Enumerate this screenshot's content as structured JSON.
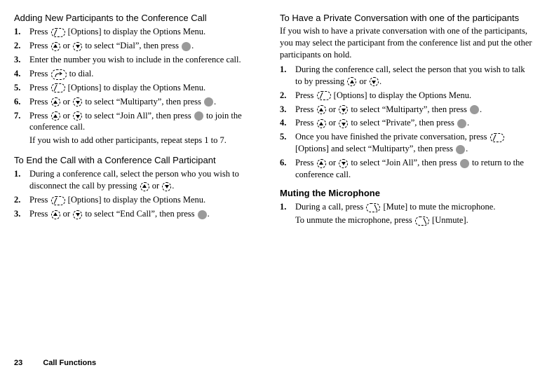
{
  "footer": {
    "page": "23",
    "section": "Call Functions"
  },
  "left": {
    "sec1": {
      "title": "Adding New Participants to the Conference Call",
      "steps": [
        {
          "n": "1.",
          "pre": "Press ",
          "after": " [Options] to display the Options Menu."
        },
        {
          "n": "2.",
          "pre": "Press ",
          "or": " or ",
          "mid": " to select “Dial”, then press ",
          "end": "."
        },
        {
          "n": "3.",
          "text": "Enter the number you wish to include in the conference call."
        },
        {
          "n": "4.",
          "pre": "Press  ",
          "end": "  to dial."
        },
        {
          "n": "5.",
          "pre": "Press ",
          "after": " [Options] to display the Options Menu."
        },
        {
          "n": "6.",
          "pre": "Press ",
          "or": " or ",
          "mid": " to select “Multiparty”, then press ",
          "end": "."
        },
        {
          "n": "7.",
          "pre": "Press ",
          "or": " or ",
          "mid": " to select “Join All”, then press ",
          "end": " to join the conference call.",
          "extra": "If you wish to add other participants, repeat steps 1 to 7."
        }
      ]
    },
    "sec2": {
      "title": "To End the Call with a Conference Call Participant",
      "steps": [
        {
          "n": "1.",
          "pre": "During a conference call, select the person who you wish to disconnect the call by pressing ",
          "or": " or ",
          "end": "."
        },
        {
          "n": "2.",
          "pre": "Press ",
          "after": " [Options] to display the Options Menu."
        },
        {
          "n": "3.",
          "pre": "Press ",
          "or": " or ",
          "mid": " to select “End Call”, then press ",
          "end": "."
        }
      ]
    }
  },
  "right": {
    "sec1": {
      "title": "To Have a Private Conversation with one of the participants",
      "intro": "If you wish to have a private conversation with one of the participants, you may select the participant from the conference list and put the other participants on hold.",
      "steps": [
        {
          "n": "1.",
          "pre": "During the conference call, select the person that you wish to talk to by pressing ",
          "or": " or ",
          "end": "."
        },
        {
          "n": "2.",
          "pre": "Press ",
          "after": " [Options] to display the Options Menu."
        },
        {
          "n": "3.",
          "pre": "Press ",
          "or": " or ",
          "mid": " to select “Multiparty”, then press ",
          "end": "."
        },
        {
          "n": "4.",
          "pre": "Press ",
          "or": " or ",
          "mid": " to select “Private”, then press ",
          "end": "."
        },
        {
          "n": "5.",
          "pre": "Once you have finished the private conversation, press ",
          "after": " [Options] and select “Multiparty”, then press ",
          "end": "."
        },
        {
          "n": "6.",
          "pre": "Press ",
          "or": " or ",
          "mid": " to select “Join All”, then press ",
          "end": " to return to the conference call."
        }
      ]
    },
    "sec2": {
      "title": "Muting the Microphone",
      "steps": [
        {
          "n": "1.",
          "pre": "During a call, press ",
          "after": " [Mute] to mute the microphone.",
          "extraPre": "To unmute the microphone, press ",
          "extraAfter": " [Unmute]."
        }
      ]
    }
  }
}
